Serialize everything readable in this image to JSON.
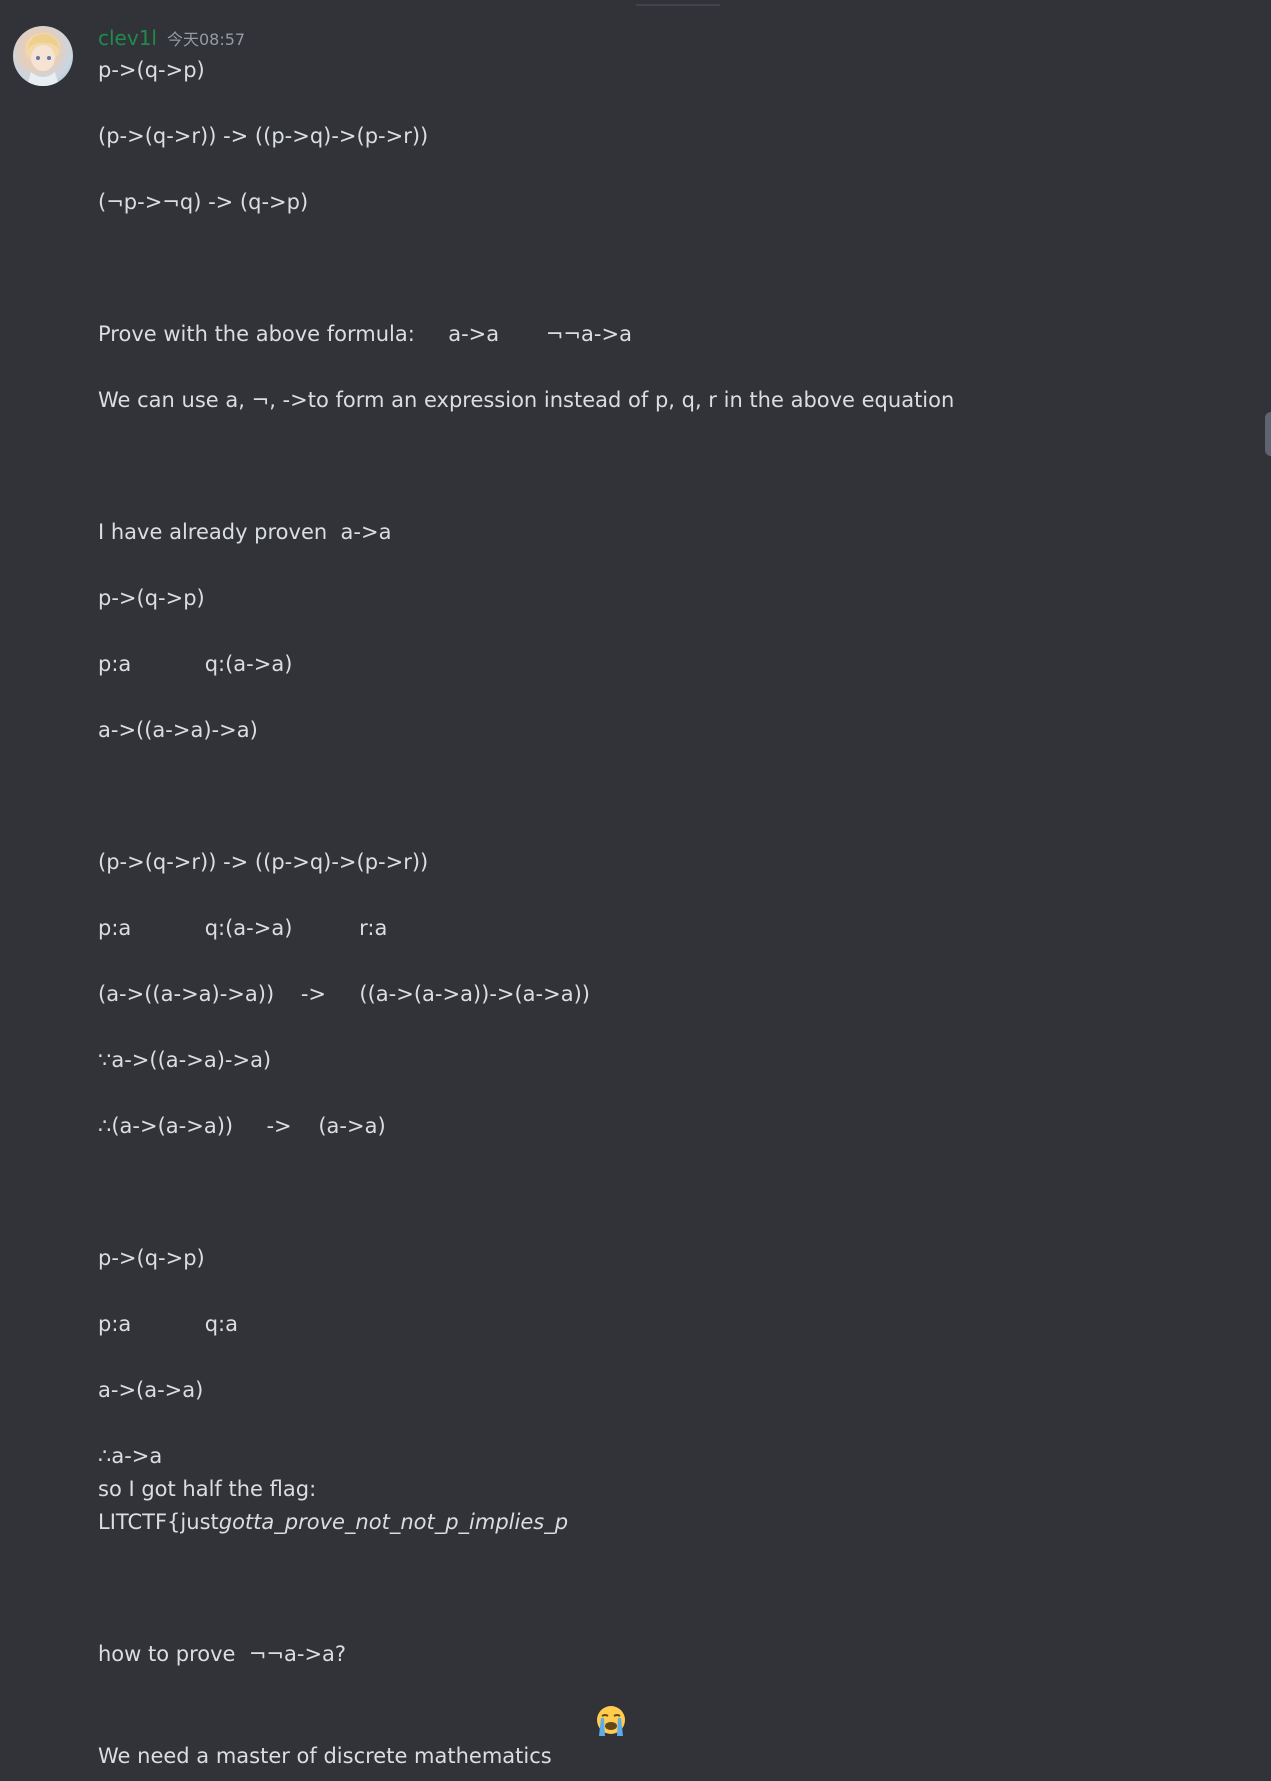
{
  "message": {
    "username": "clev1l",
    "timestamp": "今天08:57",
    "lines": {
      "l01": "p->(q->p)",
      "l02": "(p->(q->r)) -> ((p->q)->(p->r))",
      "l03": "(¬p->¬q) -> (q->p)",
      "l04": "Prove with the above formula:     a->a       ¬¬a->a",
      "l05": "We can use a, ¬, ->to form an expression instead of p, q, r in the above equation",
      "l06": "I have already proven  a->a",
      "l07": "p->(q->p)",
      "l08": "p:a           q:(a->a)",
      "l09": "a->((a->a)->a)",
      "l10": "(p->(q->r)) -> ((p->q)->(p->r))",
      "l11": "p:a           q:(a->a)          r:a",
      "l12": "(a->((a->a)->a))    ->     ((a->(a->a))->(a->a))",
      "l13": "∵a->((a->a)->a)",
      "l14": "∴(a->(a->a))     ->    (a->a)",
      "l15": "p->(q->p)",
      "l16": "p:a           q:a",
      "l17": "a->(a->a)",
      "l18": "∴a->a",
      "l19": "so I got half the flag:",
      "l20_plain": "LITCTF{just",
      "l20_italic": "gotta_prove_not_not_p_implies_p",
      "l21": "how to prove  ¬¬a->a?",
      "l22": "We need a master of discrete mathematics"
    },
    "emoji": "loudly-crying-face"
  },
  "colors": {
    "background": "#313338",
    "text": "#dbdee1",
    "username": "#1f8b4c",
    "timestamp": "#949ba4"
  }
}
